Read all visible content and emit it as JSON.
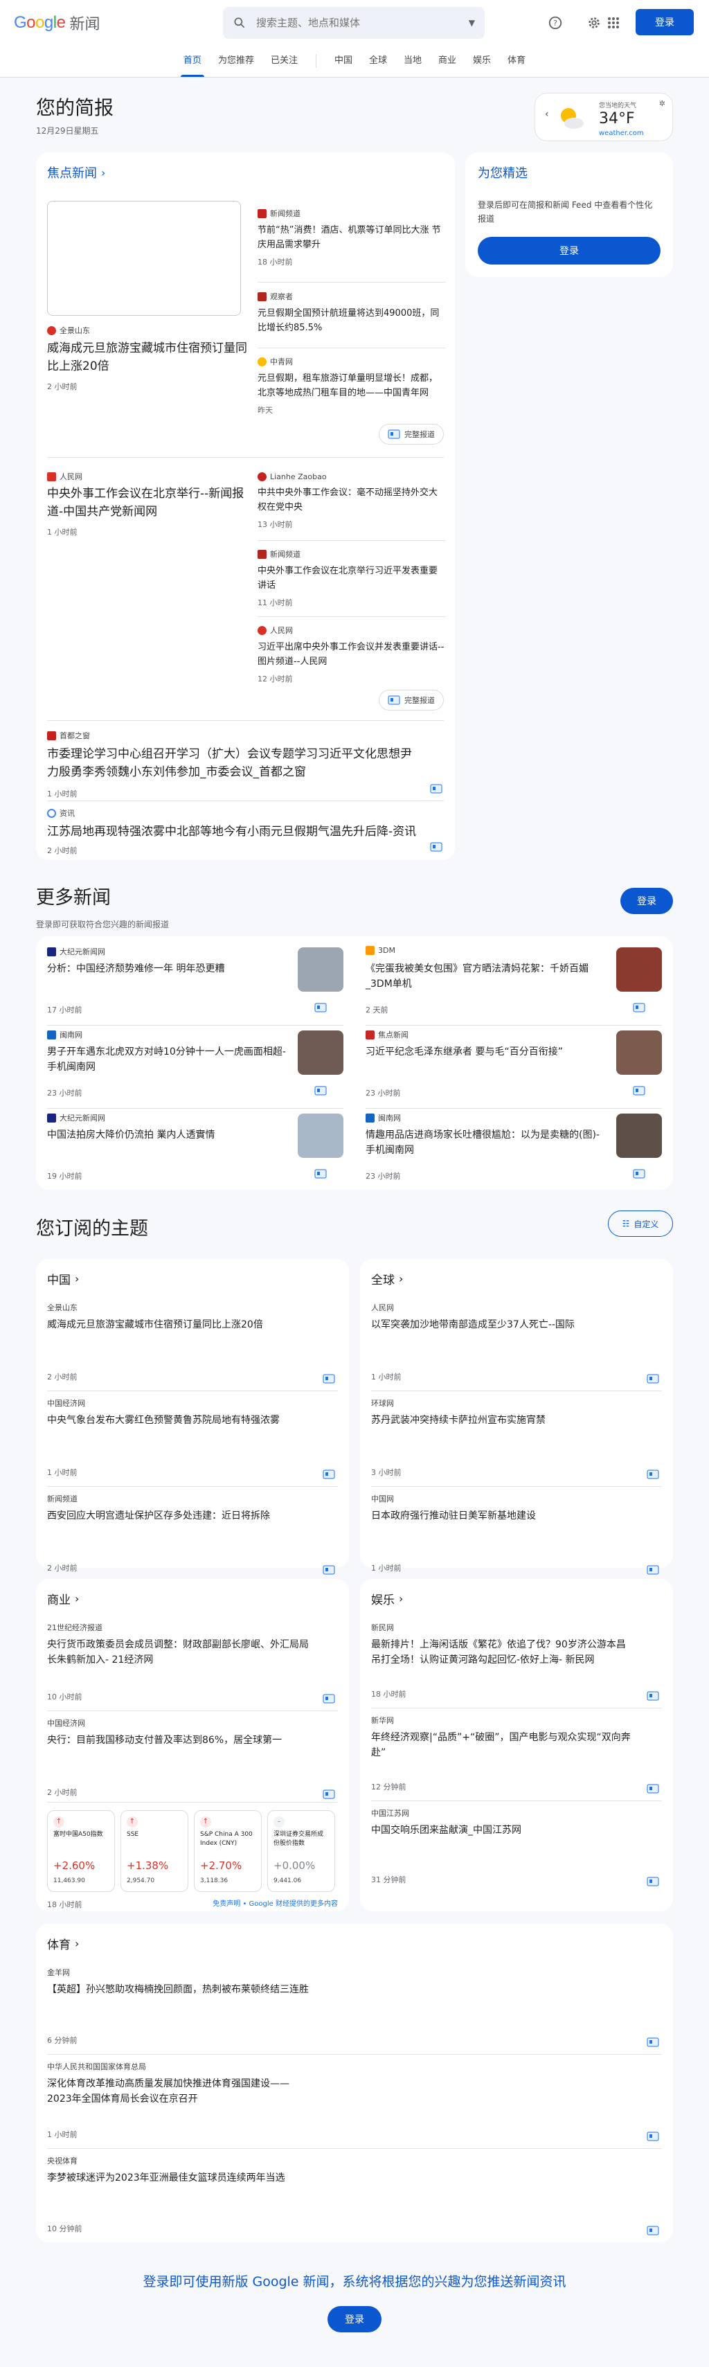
{
  "header": {
    "logo_google": "Google",
    "logo_news": "新闻",
    "search_placeholder": "搜索主题、地点和媒体",
    "signin": "登录",
    "colors": {
      "blue": "#4285f4",
      "red": "#ea4335",
      "yellow": "#fbbc04",
      "green": "#34a853"
    }
  },
  "nav": {
    "tabs": [
      "首页",
      "为您推荐",
      "已关注"
    ],
    "sections": [
      "中国",
      "全球",
      "当地",
      "商业",
      "娱乐",
      "体育"
    ],
    "active": "首页"
  },
  "briefing": {
    "title": "您的简报",
    "date": "12月29日星期五",
    "weather": {
      "label": "您当地的天气",
      "temp": "34°F",
      "source": "weather.com"
    }
  },
  "top_stories": {
    "heading": "焦点新闻",
    "cluster1": {
      "main": {
        "source": "全景山东",
        "title": "威海成元旦旅游宝藏城市住宿预订量同比上涨20倍",
        "time": "2 小时前"
      },
      "related": [
        {
          "source": "新闻频道",
          "title": "节前“热”消费！酒店、机票等订单同比大涨 节庆用品需求攀升",
          "time": "18 小时前"
        },
        {
          "source": "观察者",
          "title": "元旦假期全国预计航班量将达到49000班，同比增长约85.5%",
          "time": ""
        },
        {
          "source": "中青网",
          "title": "元旦假期，租车旅游订单量明显增长！成都，北京等地成热门租车目的地——中国青年网",
          "time": "昨天"
        }
      ],
      "full_coverage": "完整报道"
    },
    "cluster2": {
      "main": {
        "source": "人民网",
        "title": "中央外事工作会议在北京举行--新闻报道-中国共产党新闻网",
        "time": "1 小时前"
      },
      "related": [
        {
          "source": "Lianhe Zaobao",
          "title": "中共中央外事工作会议：毫不动摇坚持外交大权在党中央",
          "time": "13 小时前"
        },
        {
          "source": "新闻频道",
          "title": "中央外事工作会议在北京举行习近平发表重要讲话",
          "time": "11 小时前"
        },
        {
          "source": "人民网",
          "title": "习近平出席中央外事工作会议并发表重要讲话--图片频道--人民网",
          "time": "12 小时前"
        }
      ],
      "full_coverage": "完整报道"
    },
    "single": [
      {
        "source": "首都之窗",
        "title": "市委理论学习中心组召开学习（扩大）会议专题学习习近平文化思想尹力殷勇李秀领魏小东刘伟参加_市委会议_首都之窗",
        "time": "1 小时前"
      },
      {
        "source": "资讯",
        "title": "江苏局地再现特强浓雾中北部等地今有小雨元旦假期气温先升后降-资讯",
        "time": "2 小时前"
      }
    ]
  },
  "picks": {
    "heading": "为您精选",
    "desc": "登录后即可在简报和新闻 Feed 中查看看个性化报道",
    "button": "登录"
  },
  "more": {
    "title": "更多新闻",
    "sub": "登录即可获取符合您兴趣的新闻报道",
    "button": "登录",
    "items": [
      {
        "source": "大纪元新闻网",
        "title": "分析：中国经济颓势难修一年 明年恐更糟",
        "time": "17 小时前",
        "thumb": "#9ca6b0"
      },
      {
        "source": "3DM",
        "title": "《完蛋我被美女包围》官方晒法清妈花絮：千娇百媚_3DM单机",
        "time": "2 天前",
        "thumb": "#8a3a2e"
      },
      {
        "source": "闽南网",
        "title": "男子开车遇东北虎双方对峙10分钟十一人一虎画面相超-手机闽南网",
        "time": "23 小时前",
        "thumb": "#6e5a52"
      },
      {
        "source": "焦点新闻",
        "title": "习近平纪念毛泽东继承者 要与毛“百分百衔接”",
        "time": "23 小时前",
        "thumb": "#7b5b4c"
      },
      {
        "source": "大纪元新闻网",
        "title": "中国法拍房大降价仍流拍 業内人透實情",
        "time": "19 小时前",
        "thumb": "#a9b8c8"
      },
      {
        "source": "闽南网",
        "title": "情趣用品店进商场家长吐槽很尴尬：以为是卖糖的(图)-手机闽南网",
        "time": "23 小时前",
        "thumb": "#5c5048"
      }
    ]
  },
  "subscribed": {
    "title": "您订阅的主题",
    "customize": "自定义",
    "topics": [
      {
        "name": "中国",
        "items": [
          {
            "source": "全景山东",
            "title": "威海成元旦旅游宝藏城市住宿预订量同比上涨20倍",
            "time": "2 小时前"
          },
          {
            "source": "中国经济网",
            "title": "中央气象台发布大雾红色预警黄鲁苏院局地有特强浓雾",
            "time": "1 小时前"
          },
          {
            "source": "新闻频道",
            "title": "西安回应大明宫遗址保护区存多处违建：近日将拆除",
            "time": "2 小时前"
          }
        ]
      },
      {
        "name": "全球",
        "items": [
          {
            "source": "人民网",
            "title": "以军突袭加沙地带南部造成至少37人死亡--国际",
            "time": "1 小时前"
          },
          {
            "source": "环球网",
            "title": "苏丹武装冲突持续卡萨拉州宣布实施宵禁",
            "time": "3 小时前"
          },
          {
            "source": "中国网",
            "title": "日本政府强行推动驻日美军新基地建设",
            "time": "1 小时前"
          }
        ]
      },
      {
        "name": "商业",
        "items": [
          {
            "source": "21世纪经济报道",
            "title": "央行货币政策委员会成员调整：财政部副部长廖岷、外汇局局长朱鹤新加入- 21经济网",
            "time": "10 小时前"
          },
          {
            "source": "中国经济网",
            "title": "央行：目前我国移动支付普及率达到86%，居全球第一",
            "time": "2 小时前"
          }
        ]
      },
      {
        "name": "娱乐",
        "items": [
          {
            "source": "新民网",
            "title": "最新排片！上海闲话版《繁花》依追了伐？90岁济公游本昌吊打全场！认购证黄河路勾起回忆-依好上海- 新民网",
            "time": "18 小时前"
          },
          {
            "source": "新华网",
            "title": "年终经济观察|“品质”+“破圈”，国产电影与观众实现“双向奔赴”",
            "time": "12 分钟前"
          },
          {
            "source": "中国江苏网",
            "title": "中国交响乐团来盐献演_中国江苏网",
            "time": "31 分钟前"
          }
        ]
      }
    ],
    "markets": [
      {
        "name": "富时中国A50指数",
        "change": "+2.60%",
        "value": "11,463.90",
        "color": "#d93025"
      },
      {
        "name": "SSE",
        "change": "+1.38%",
        "value": "2,954.70",
        "color": "#d93025"
      },
      {
        "name": "S&P China A 300 Index (CNY)",
        "change": "+2.70%",
        "value": "3,118.36",
        "color": "#d93025"
      },
      {
        "name": "深圳证券交易所成份股价指数",
        "change": "+0.00%",
        "value": "9,441.06",
        "color": "#80868b"
      }
    ],
    "markets_time": "18 小时前",
    "markets_disclaimer": "免责声明 • Google 财经提供的更多内容",
    "sports": {
      "name": "体育",
      "items": [
        {
          "source": "金羊网",
          "title": "【英超】孙兴慜助攻梅楠挽回颜面，热刺被布莱顿终结三连胜",
          "time": "6 分钟前"
        },
        {
          "source": "中华人民共和国国家体育总局",
          "title": "深化体育改革推动高质量发展加快推进体育强国建设——2023年全国体育局长会议在京召开",
          "time": "1 小时前"
        },
        {
          "source": "央视体育",
          "title": "李梦被球迷评为2023年亚洲最佳女篮球员连续两年当选",
          "time": "10 分钟前"
        }
      ]
    }
  },
  "footer": {
    "prompt": "登录即可使用新版 Google 新闻，系统将根据您的兴趣为您推送新闻资讯",
    "button": "登录"
  }
}
